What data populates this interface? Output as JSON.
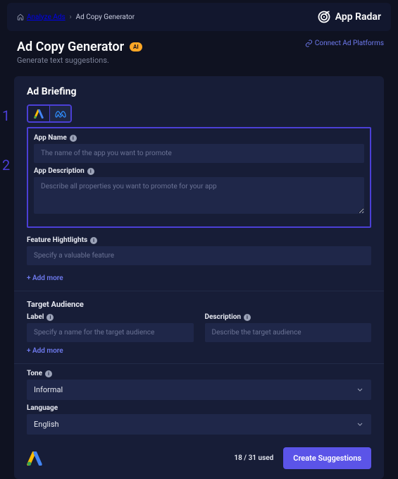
{
  "breadcrumb": {
    "root": "Analyze Ads",
    "leaf": "Ad Copy Generator"
  },
  "brand": {
    "name": "App Radar"
  },
  "page": {
    "title": "Ad Copy Generator",
    "badge": "AI",
    "subtitle": "Generate text suggestions."
  },
  "connect": {
    "label": "Connect Ad Platforms"
  },
  "panel": {
    "title": "Ad Briefing"
  },
  "app_name": {
    "label": "App Name",
    "placeholder": "The name of the app you want to promote"
  },
  "app_desc": {
    "label": "App Description",
    "placeholder": "Describe all properties you want to promote for your app"
  },
  "features": {
    "label": "Feature Hightlights",
    "placeholder": "Specify a valuable feature",
    "add": "+  Add more"
  },
  "audience": {
    "section": "Target Audience",
    "label_label": "Label",
    "label_placeholder": "Specify a name for the target audience",
    "desc_label": "Description",
    "desc_placeholder": "Describe the target audience",
    "add": "+  Add more"
  },
  "tone": {
    "label": "Tone",
    "value": "Informal"
  },
  "language": {
    "label": "Language",
    "value": "English"
  },
  "footer": {
    "usage": "18 / 31 used",
    "cta": "Create Suggestions"
  },
  "markers": {
    "one": "1",
    "two": "2"
  }
}
